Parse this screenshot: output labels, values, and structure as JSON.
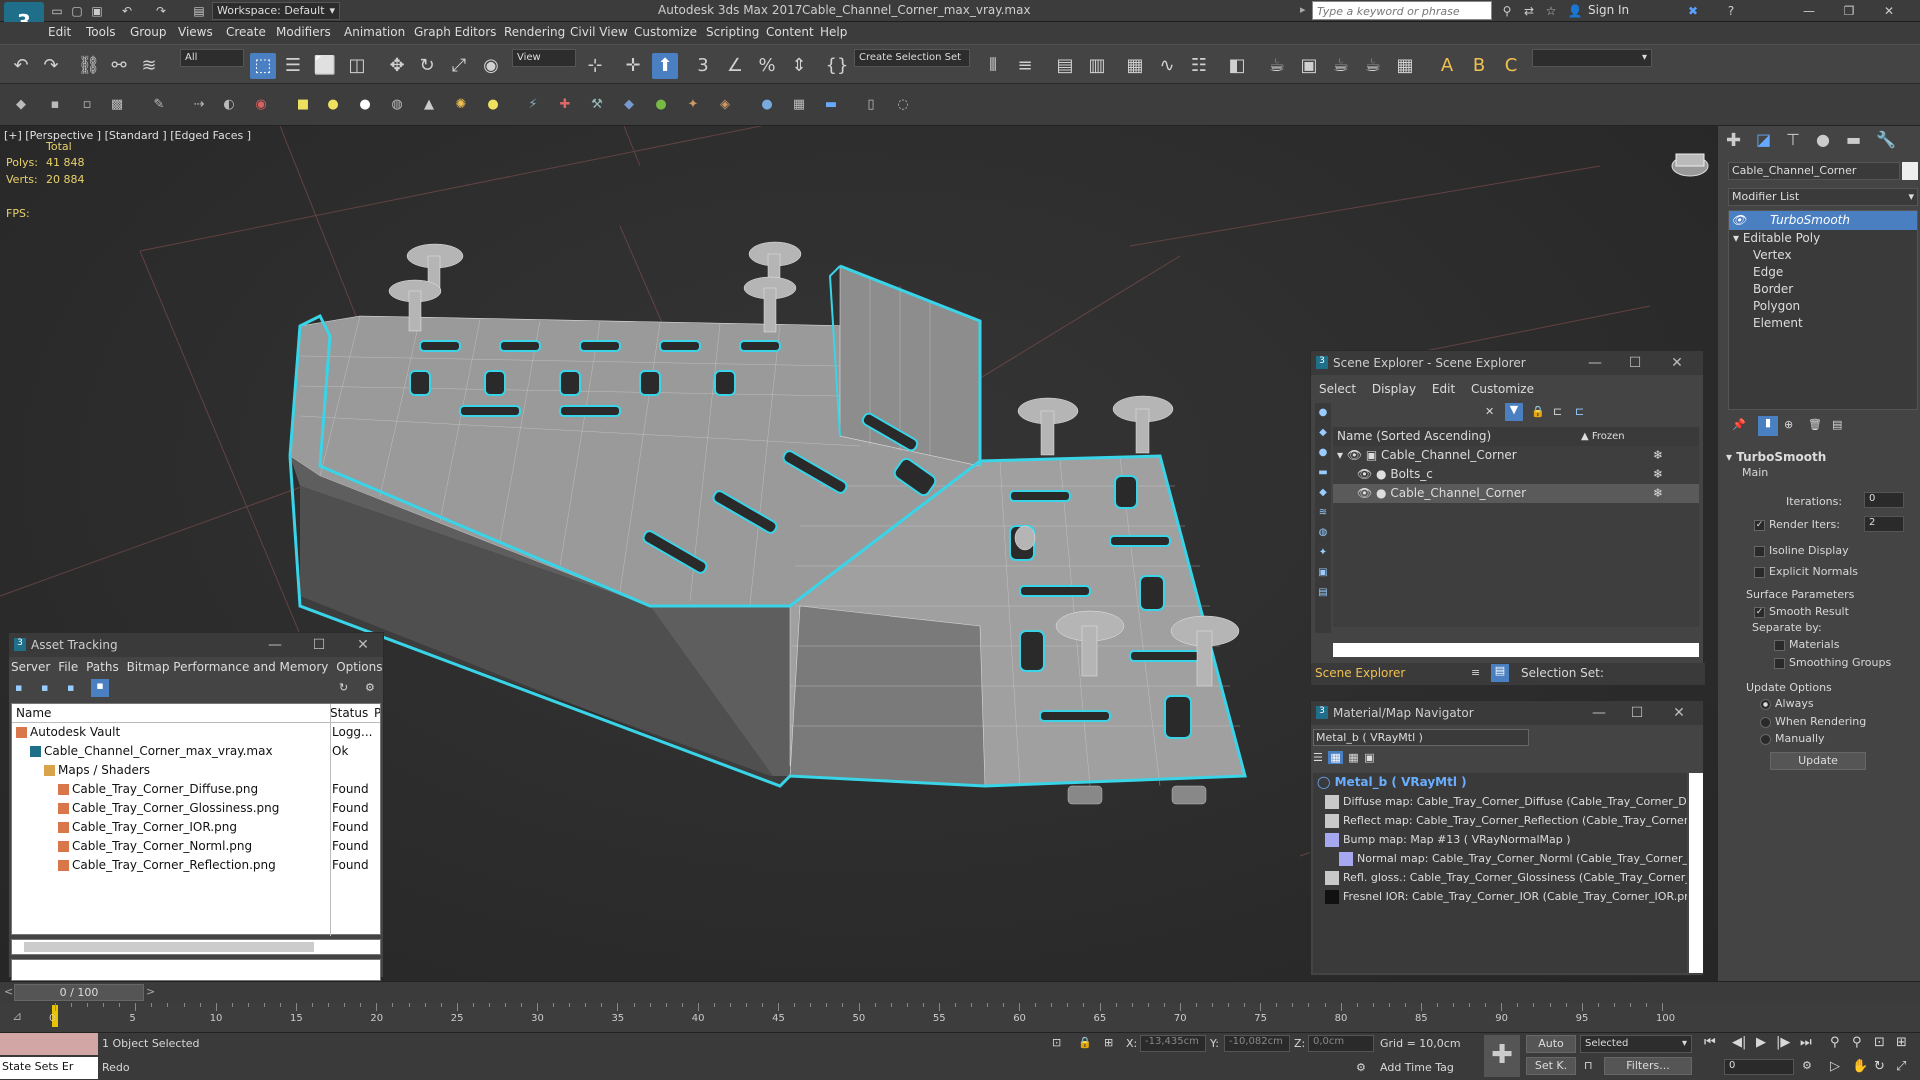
{
  "app": {
    "logo": "3",
    "title": "Autodesk 3ds Max 2017",
    "file": "Cable_Channel_Corner_max_vray.max",
    "workspace": "Workspace: Default",
    "search_placeholder": "Type a keyword or phrase",
    "sign_in": "Sign In"
  },
  "menu": [
    "Edit",
    "Tools",
    "Group",
    "Views",
    "Create",
    "Modifiers",
    "Animation",
    "Graph Editors",
    "Rendering",
    "Civil View",
    "Customize",
    "Scripting",
    "Content",
    "Help"
  ],
  "toolbar": {
    "filter": "All",
    "view": "View",
    "selection_set": "Create Selection Set"
  },
  "viewport": {
    "label": "[+] [Perspective ] [Standard ] [Edged Faces ]",
    "total": "Total",
    "polys_label": "Polys:",
    "polys": "41 848",
    "verts_label": "Verts:",
    "verts": "20 884",
    "fps": "FPS:"
  },
  "command_panel": {
    "object_name": "Cable_Channel_Corner",
    "modifier_list": "Modifier List",
    "stack": [
      {
        "label": "TurboSmooth",
        "selected": true
      },
      {
        "label": "Editable Poly"
      },
      {
        "label": "Vertex"
      },
      {
        "label": "Edge"
      },
      {
        "label": "Border"
      },
      {
        "label": "Polygon"
      },
      {
        "label": "Element"
      }
    ],
    "turbosmooth": {
      "title": "TurboSmooth",
      "main": "Main",
      "iterations_label": "Iterations:",
      "iterations": "0",
      "render_iters_label": "Render Iters:",
      "render_iters": "2",
      "isoline": "Isoline Display",
      "explicit_normals": "Explicit Normals",
      "surface_params": "Surface Parameters",
      "smooth_result": "Smooth Result",
      "separate_by": "Separate by:",
      "materials": "Materials",
      "smoothing_groups": "Smoothing Groups",
      "update_options": "Update Options",
      "always": "Always",
      "when_rendering": "When Rendering",
      "manually": "Manually",
      "update": "Update"
    }
  },
  "scene_explorer": {
    "title": "Scene Explorer - Scene Explorer",
    "menu": [
      "Select",
      "Display",
      "Edit",
      "Customize"
    ],
    "col_name": "Name (Sorted Ascending)",
    "col_frozen": "▲ Frozen",
    "items": [
      "Cable_Channel_Corner",
      "Bolts_c",
      "Cable_Channel_Corner"
    ],
    "footer_left": "Scene Explorer",
    "footer_right": "Selection Set:"
  },
  "material_nav": {
    "title": "Material/Map Navigator",
    "current": "Metal_b  ( VRayMtl )",
    "root": "Metal_b  ( VRayMtl )",
    "items": [
      "Diffuse map: Cable_Tray_Corner_Diffuse (Cable_Tray_Corner_Diffuse.p",
      "Reflect map: Cable_Tray_Corner_Reflection (Cable_Tray_Corner_Reflec",
      "Bump map: Map #13  ( VRayNormalMap )",
      "Normal map: Cable_Tray_Corner_Norml (Cable_Tray_Corner_Norml.p",
      "Refl. gloss.: Cable_Tray_Corner_Glossiness (Cable_Tray_Corner_Glossin",
      "Fresnel IOR: Cable_Tray_Corner_IOR (Cable_Tray_Corner_IOR.png)"
    ]
  },
  "asset_tracking": {
    "title": "Asset Tracking",
    "menu": [
      "Server",
      "File",
      "Paths",
      "Bitmap Performance and Memory",
      "Options"
    ],
    "col_name": "Name",
    "col_status": "Status",
    "col_p": "P",
    "rows": [
      {
        "name": "Autodesk Vault",
        "status": "Logg...",
        "indent": 0
      },
      {
        "name": "Cable_Channel_Corner_max_vray.max",
        "status": "Ok",
        "indent": 1
      },
      {
        "name": "Maps / Shaders",
        "status": "",
        "indent": 2
      },
      {
        "name": "Cable_Tray_Corner_Diffuse.png",
        "status": "Found",
        "indent": 3
      },
      {
        "name": "Cable_Tray_Corner_Glossiness.png",
        "status": "Found",
        "indent": 3
      },
      {
        "name": "Cable_Tray_Corner_IOR.png",
        "status": "Found",
        "indent": 3
      },
      {
        "name": "Cable_Tray_Corner_Norml.png",
        "status": "Found",
        "indent": 3
      },
      {
        "name": "Cable_Tray_Corner_Reflection.png",
        "status": "Found",
        "indent": 3
      }
    ]
  },
  "timeline": {
    "frame": "0 / 100",
    "ticks": [
      "0",
      "5",
      "10",
      "15",
      "20",
      "25",
      "30",
      "35",
      "40",
      "45",
      "50",
      "55",
      "60",
      "65",
      "70",
      "75",
      "80",
      "85",
      "90",
      "95",
      "100"
    ]
  },
  "status": {
    "state_sets": "State Sets Er",
    "selected": "1 Object Selected",
    "redo": "Redo",
    "x_label": "X:",
    "x": "-13,435cm",
    "y_label": "Y:",
    "y": "-10,082cm",
    "z_label": "Z:",
    "z": "0,0cm",
    "grid": "Grid = 10,0cm",
    "add_time_tag": "Add Time Tag",
    "auto": "Auto",
    "set_k": "Set K.",
    "selected_dd": "Selected",
    "filters": "Filters...",
    "frame_spin": "0"
  },
  "colors": {
    "selection": "#39d4e8",
    "accent": "#4a7fc1",
    "stat": "#e8d26a"
  }
}
